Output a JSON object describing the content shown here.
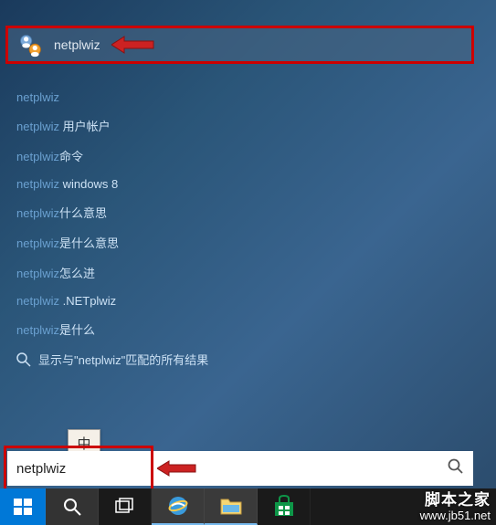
{
  "topResult": {
    "label": "netplwiz"
  },
  "search": {
    "value": "netplwiz",
    "query": "netplwiz"
  },
  "ime": {
    "label": "中"
  },
  "suggestions": [
    {
      "typed": "netplwiz",
      "rest": ""
    },
    {
      "typed": "netplwiz",
      "rest": " 用户帐户"
    },
    {
      "typed": "netplwiz",
      "rest": "命令"
    },
    {
      "typed": "netplwiz",
      "rest": " windows 8"
    },
    {
      "typed": "netplwiz",
      "rest": "什么意思"
    },
    {
      "typed": "netplwiz",
      "rest": "是什么意思"
    },
    {
      "typed": "netplwiz",
      "rest": "怎么进"
    },
    {
      "typed": "netplwiz",
      "rest": " .NETplwiz"
    },
    {
      "typed": "netplwiz",
      "rest": "是什么"
    }
  ],
  "showAll": {
    "prefix": "显示与\"",
    "term": "netplwiz",
    "suffix": "\"匹配的所有结果"
  },
  "watermark": {
    "line1": "脚本之家",
    "line2": "www.jb51.net"
  }
}
